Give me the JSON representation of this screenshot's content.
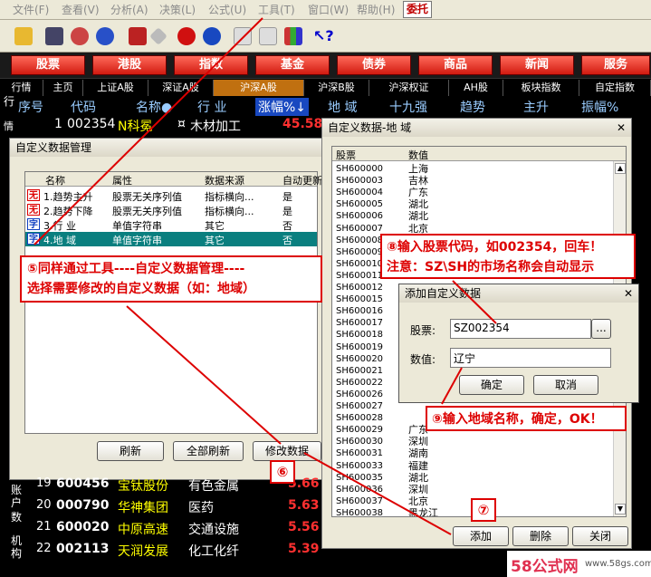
{
  "menu": [
    "文件(F)",
    "查看(V)",
    "分析(A)",
    "决策(L)",
    "公式(U)",
    "工具(T)",
    "窗口(W)",
    "帮助(H)",
    "委托"
  ],
  "categories": [
    "股票",
    "港股",
    "指数",
    "基金",
    "债券",
    "商品",
    "新闻",
    "服务"
  ],
  "tabs": [
    "行情",
    "主页",
    "上证A股",
    "深证A股",
    "沪深A股",
    "沪深B股",
    "沪深权证",
    "AH股",
    "板块指数",
    "自定指数"
  ],
  "columns": {
    "seq": "序号",
    "code": "代码",
    "name": "名称●",
    "industry": "行 业",
    "change": "涨幅%↓",
    "region": "地 域",
    "shiqiang": "十九强",
    "trend": "趋势",
    "rise": "主升",
    "amplitude": "振幅%"
  },
  "top_row": {
    "seq": "1",
    "code": "002354",
    "name": "N科冕",
    "industry": "木材加工",
    "change": "45.58"
  },
  "side_tabs": {
    "a": "行",
    "b": "情",
    "c": "账户",
    "d": "数",
    "e": "机构"
  },
  "bottom_rows": [
    {
      "seq": "19",
      "code": "600456",
      "name": "宝钛股份",
      "industry": "有色金属",
      "change": "5.66"
    },
    {
      "seq": "20",
      "code": "000790",
      "name": "华神集团",
      "industry": "医药",
      "change": "5.63"
    },
    {
      "seq": "21",
      "code": "600020",
      "name": "中原高速",
      "industry": "交通设施",
      "change": "5.56"
    },
    {
      "seq": "22",
      "code": "002113",
      "name": "天润发展",
      "industry": "化工化纤",
      "change": "5.39"
    }
  ],
  "manage_dialog": {
    "title": "自定义数据管理",
    "headers": [
      "名称",
      "属性",
      "数据来源",
      "自动更新"
    ],
    "rows": [
      {
        "name": "1.趋势主升",
        "attr": "股票无关序列值",
        "source": "指标横向...",
        "auto": "是"
      },
      {
        "name": "2.趋势下降",
        "attr": "股票无关序列值",
        "source": "指标横向...",
        "auto": "是"
      },
      {
        "name": "3.行 业",
        "attr": "单值字符串",
        "source": "其它",
        "auto": "否"
      },
      {
        "name": "4.地 域",
        "attr": "单值字符串",
        "source": "其它",
        "auto": "否"
      }
    ],
    "btn_refresh": "刷新",
    "btn_refresh_all": "全部刷新",
    "btn_modify": "修改数据"
  },
  "region_dialog": {
    "title": "自定义数据-地  域",
    "headers": [
      "股票",
      "数值"
    ],
    "rows": [
      [
        "SH600000",
        "上海"
      ],
      [
        "SH600003",
        "吉林"
      ],
      [
        "SH600004",
        "广东"
      ],
      [
        "SH600005",
        "湖北"
      ],
      [
        "SH600006",
        "湖北"
      ],
      [
        "SH600007",
        "北京"
      ],
      [
        "SH600008",
        ""
      ],
      [
        "SH600009",
        ""
      ],
      [
        "SH600010",
        ""
      ],
      [
        "SH600011",
        ""
      ],
      [
        "SH600012",
        ""
      ],
      [
        "SH600015",
        ""
      ],
      [
        "SH600016",
        ""
      ],
      [
        "SH600017",
        ""
      ],
      [
        "SH600018",
        ""
      ],
      [
        "SH600019",
        ""
      ],
      [
        "SH600020",
        ""
      ],
      [
        "SH600021",
        ""
      ],
      [
        "SH600022",
        ""
      ],
      [
        "SH600026",
        ""
      ],
      [
        "SH600027",
        ""
      ],
      [
        "SH600028",
        ""
      ],
      [
        "SH600029",
        "广东"
      ],
      [
        "SH600030",
        "深圳"
      ],
      [
        "SH600031",
        "湖南"
      ],
      [
        "SH600033",
        "福建"
      ],
      [
        "SH600035",
        "湖北"
      ],
      [
        "SH600036",
        "深圳"
      ],
      [
        "SH600037",
        "北京"
      ],
      [
        "SH600038",
        "黑龙江"
      ]
    ],
    "btn_add": "添加",
    "btn_delete": "删除",
    "btn_close": "关闭"
  },
  "add_dialog": {
    "title": "添加自定义数据",
    "label_stock": "股票:",
    "stock_value": "SZ002354",
    "browse": "...",
    "label_value": "数值:",
    "value_value": "辽宁",
    "btn_ok": "确定",
    "btn_cancel": "取消"
  },
  "callouts": {
    "c5": "⑤同样通过工具----自定义数据管理----\n选择需要修改的自定义数据（如：地域）",
    "c8": "⑧输入股票代码，如002354，回车！\n注意：SZ\\SH的市场名称会自动显示",
    "c9": "⑨输入地域名称，确定，OK！",
    "b6": "⑥",
    "b7": "⑦"
  },
  "watermark": {
    "brand": "58公式网",
    "url": "www.58gs.com"
  },
  "colors": {
    "accent_red": "#d00000",
    "selected_row": "#0a7f7f",
    "stock_yellow": "#ffff00",
    "code_white": "#ffffff",
    "change_red": "#ff3030"
  }
}
